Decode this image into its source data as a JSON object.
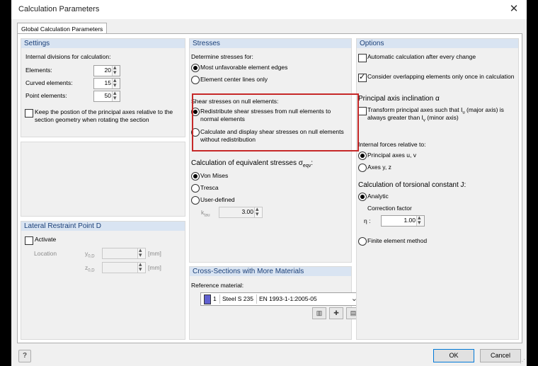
{
  "window": {
    "title": "Calculation Parameters"
  },
  "tab": {
    "label": "Global Calculation Parameters"
  },
  "settings": {
    "header": "Settings",
    "divisions_label": "Internal divisions for calculation:",
    "elements_label": "Elements:",
    "elements_value": "20",
    "curved_label": "Curved elements:",
    "curved_value": "15",
    "point_label": "Point elements:",
    "point_value": "50",
    "keep_label_1": "Keep the postion of the principal axes relative to the",
    "keep_label_2": "section geometry when rotating the section"
  },
  "lateral": {
    "header": "Lateral Restraint Point D",
    "activate_label": "Activate",
    "location_label": "Location",
    "y_label": "y",
    "z_label": "z",
    "sub_label": "0,D",
    "unit": "[mm]"
  },
  "stresses": {
    "header": "Stresses",
    "determine_label": "Determine stresses for:",
    "opt_edges": "Most unfavorable element edges",
    "opt_centers": "Element center lines only",
    "shear_label": "Shear stresses on null elements:",
    "redistribute_1": "Redistribute shear stresses from null elements to",
    "redistribute_2": "normal elements",
    "calc_display_1": "Calculate and display shear stresses on null elements",
    "calc_display_2": "without redistribution",
    "equiv_label": "Calculation of equivalent stresses σ",
    "equiv_sub": "eqv",
    "equiv_colon": ":",
    "von_mises": "Von Mises",
    "tresca": "Tresca",
    "user_defined": "User-defined",
    "ktau_label": "k",
    "ktau_sub": "tau",
    "ktau_value": "3.00"
  },
  "cross": {
    "header": "Cross-Sections with More Materials",
    "ref_label": "Reference material:",
    "mat_num": "1",
    "mat_name": "Steel S 235",
    "mat_norm": "EN 1993-1-1:2005-05",
    "swatch_color": "#6060d0"
  },
  "options": {
    "header": "Options",
    "auto_calc": "Automatic calculation after every change",
    "overlap": "Consider overlapping elements only once in calculation",
    "principal_label": "Principal axis inclination α",
    "transform_1": "Transform principal axes such that I",
    "transform_u": "u",
    "transform_2": " (major axis) is",
    "transform_3": "always greater than I",
    "transform_v": "v",
    "transform_4": " (minor axis)",
    "forces_label": "Internal forces relative to:",
    "axes_uv": "Principal axes u, v",
    "axes_yz": "Axes y, z",
    "torsional_label": "Calculation of torsional constant J:",
    "analytic": "Analytic",
    "correction_label": "Correction factor",
    "eta_label": "η :",
    "eta_value": "1.00",
    "fem": "Finite element method"
  },
  "footer": {
    "ok": "OK",
    "cancel": "Cancel"
  }
}
